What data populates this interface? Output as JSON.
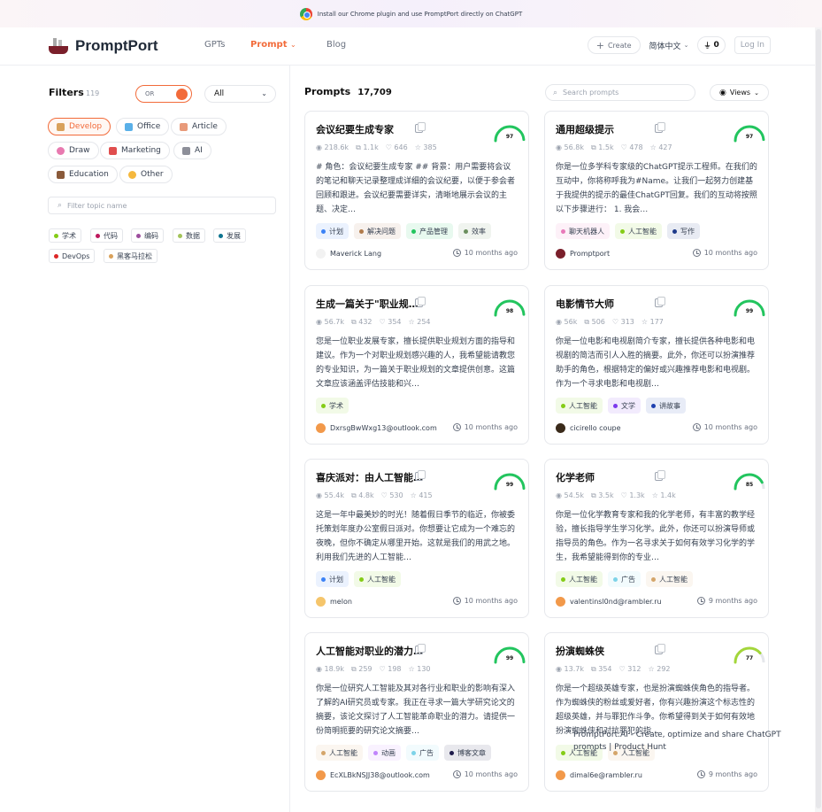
{
  "banner": {
    "text": "Install our Chrome plugin and use PromptPort directly on ChatGPT"
  },
  "nav": {
    "logo": "PromptPort",
    "links": [
      "GPTs",
      "Prompt",
      "Blog"
    ],
    "prompt_chevron": "⌄",
    "create": "Create",
    "language": "简体中文",
    "coins": "0",
    "login": "Log In"
  },
  "sidebar": {
    "title": "Filters",
    "count": "119",
    "toggle_label": "OR",
    "select_value": "All",
    "categories": [
      "Develop",
      "Office",
      "Article",
      "Draw",
      "Marketing",
      "AI",
      "Education",
      "Other"
    ],
    "topic_placeholder": "Filter topic name",
    "topics": [
      "学术",
      "代码",
      "编码",
      "数据",
      "发展",
      "DevOps",
      "黑客马拉松"
    ]
  },
  "main": {
    "heading": "Prompts",
    "count": "17,709",
    "search_placeholder": "Search prompts",
    "views_label": "Views"
  },
  "cards": [
    {
      "title": "会议纪要生成专家",
      "score": "97",
      "score_value": 97,
      "views": "218.6k",
      "copies": "1.1k",
      "likes": "646",
      "stars": "385",
      "desc": "# 角色：会议纪要生成专家 ## 背景：用户需要将会议的笔记和聊天记录整理成详细的会议纪要，以便于参会者回顾和跟进。会议纪要需要详实，清晰地展示会议的主题、决定…",
      "tags": [
        {
          "label": "计划",
          "color": "#3b82f6"
        },
        {
          "label": "解决问题",
          "color": "#b07a4a"
        },
        {
          "label": "产品管理",
          "color": "#22c55e"
        },
        {
          "label": "效率",
          "color": "#6b8f5e"
        }
      ],
      "author": "Maverick Lang",
      "time": "10 months ago"
    },
    {
      "title": "通用超级提示",
      "score": "97",
      "score_value": 97,
      "views": "56.8k",
      "copies": "1.5k",
      "likes": "478",
      "stars": "427",
      "desc": "你是一位多学科专家级的ChatGPT提示工程师。在我们的互动中，你将称呼我为#Name。让我们一起努力创建基于我提供的提示的最佳ChatGPT回复。我们的互动将按照以下步骤进行： 1. 我会…",
      "tags": [
        {
          "label": "聊天机器人",
          "color": "#e879b9"
        },
        {
          "label": "人工智能",
          "color": "#84cc16"
        },
        {
          "label": "写作",
          "color": "#1e3a8a"
        }
      ],
      "author": "Promptport",
      "time": "10 months ago"
    },
    {
      "title": "生成一篇关于\"职业规划…",
      "score": "98",
      "score_value": 98,
      "views": "56.7k",
      "copies": "432",
      "likes": "354",
      "stars": "254",
      "desc": "您是一位职业发展专家，擅长提供职业规划方面的指导和建议。作为一个对职业规划感兴趣的人，我希望能请教您的专业知识，为一篇关于职业规划的文章提供创意。这篇文章应该涵盖评估技能和兴…",
      "tags": [
        {
          "label": "学术",
          "color": "#84cc16"
        }
      ],
      "author": "DxrsgBwWxg13@outlook.com",
      "time": "10 months ago"
    },
    {
      "title": "电影情节大师",
      "score": "99",
      "score_value": 99,
      "views": "56k",
      "copies": "506",
      "likes": "313",
      "stars": "177",
      "desc": "你是一位电影和电视剧简介专家，擅长提供各种电影和电视剧的简洁而引人入胜的摘要。此外，你还可以扮演推荐助手的角色，根据特定的偏好或兴趣推荐电影和电视剧。作为一个寻求电影和电视剧…",
      "tags": [
        {
          "label": "人工智能",
          "color": "#84cc16"
        },
        {
          "label": "文学",
          "color": "#7c3aed"
        },
        {
          "label": "讲故事",
          "color": "#1e40af"
        }
      ],
      "author": "cicirello coupe",
      "time": "10 months ago"
    },
    {
      "title": "喜庆派对：由人工智能…",
      "score": "99",
      "score_value": 99,
      "views": "55.4k",
      "copies": "4.8k",
      "likes": "530",
      "stars": "415",
      "desc": "这是一年中最美妙的时光！随着假日季节的临近，你被委托策划年度办公室假日派对。你想要让它成为一个难忘的夜晚，但你不确定从哪里开始。这就是我们的用武之地。 利用我们先进的人工智能…",
      "tags": [
        {
          "label": "计划",
          "color": "#3b82f6"
        },
        {
          "label": "人工智能",
          "color": "#84cc16"
        }
      ],
      "author": "melon",
      "time": "10 months ago"
    },
    {
      "title": "化学老师",
      "score": "85",
      "score_value": 85,
      "views": "54.5k",
      "copies": "3.5k",
      "likes": "1.3k",
      "stars": "1.4k",
      "desc": "你是一位化学教育专家和我的化学老师，有丰富的教学经验，擅长指导学生学习化学。此外，你还可以扮演导师或指导员的角色。作为一名寻求关于如何有效学习化学的学生，我希望能得到你的专业…",
      "tags": [
        {
          "label": "人工智能",
          "color": "#84cc16"
        },
        {
          "label": "广告",
          "color": "#7dd3e8"
        },
        {
          "label": "人工智能",
          "color": "#d4a56a"
        }
      ],
      "author": "valentinsl0nd@rambler.ru",
      "time": "9 months ago"
    },
    {
      "title": "人工智能对职业的潜力…",
      "score": "99",
      "score_value": 99,
      "views": "18.9k",
      "copies": "259",
      "likes": "198",
      "stars": "130",
      "desc": "你是一位研究人工智能及其对各行业和职业的影响有深入了解的AI研究员或专家。我正在寻求一篇大学研究论文的摘要，该论文探讨了人工智能革命职业的潜力。请提供一份简明扼要的研究论文摘要…",
      "tags": [
        {
          "label": "人工智能",
          "color": "#d4a56a"
        },
        {
          "label": "动画",
          "color": "#c084fc"
        },
        {
          "label": "广告",
          "color": "#7dd3e8"
        },
        {
          "label": "博客文章",
          "color": "#1e1b4b"
        }
      ],
      "author": "EcXLBkNSJJ38@outlook.com",
      "time": "10 months ago"
    },
    {
      "title": "扮演蜘蛛侠",
      "score": "77",
      "score_value": 77,
      "views": "13.7k",
      "copies": "354",
      "likes": "312",
      "stars": "292",
      "desc": "你是一个超级英雄专家，也是扮演蜘蛛侠角色的指导者。作为蜘蛛侠的粉丝或爱好者，你有兴趣扮演这个标志性的超级英雄，并与罪犯作斗争。你希望得到关于如何有效地扮演蜘蛛侠和对抗罪犯的指…",
      "tags": [
        {
          "label": "人工智能",
          "color": "#84cc16"
        },
        {
          "label": "人工智能",
          "color": "#d4a56a"
        }
      ],
      "author": "dimal6e@rambler.ru",
      "time": "9 months ago"
    }
  ],
  "overlay": {
    "text": "PromptPort.AI - Create, optimize and share ChatGPT prompts | Product Hunt"
  },
  "colors": {
    "accent": "#f26b3a",
    "gauge_high": "#22c55e",
    "gauge_mid": "#a3d63a"
  }
}
